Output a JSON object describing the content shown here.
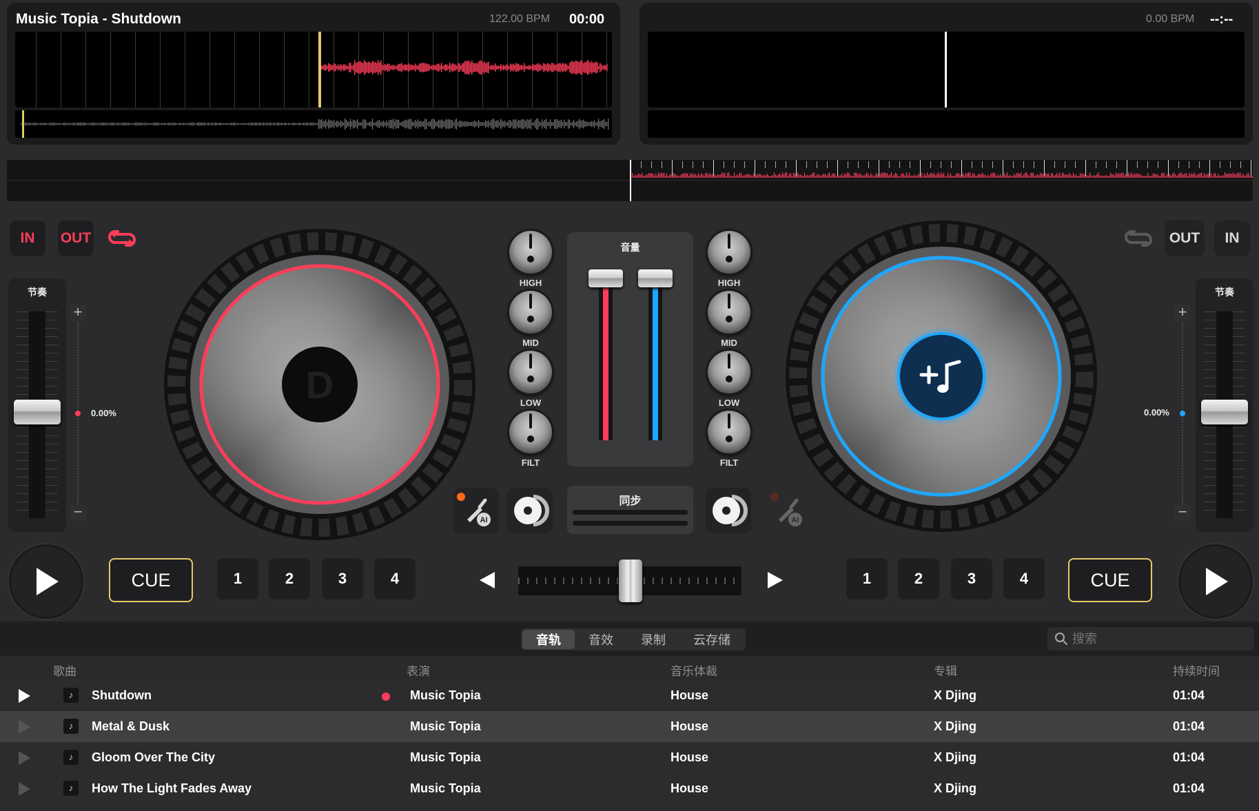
{
  "deckA": {
    "title": "Music Topia - Shutdown",
    "bpm": "122.00 BPM",
    "time": "00:00",
    "pitch_value": "0.00%",
    "pitch_label": "节奏",
    "accent": "#ff3d5a"
  },
  "deckB": {
    "bpm": "0.00 BPM",
    "time": "--:--",
    "pitch_value": "0.00%",
    "pitch_label": "节奏",
    "accent": "#1ea7ff"
  },
  "loop": {
    "in": "IN",
    "out": "OUT"
  },
  "eq": {
    "high": "HIGH",
    "mid": "MID",
    "low": "LOW",
    "filt": "FILT"
  },
  "mixer": {
    "volume_label": "音量",
    "sync_label": "同步"
  },
  "transport": {
    "cue": "CUE",
    "pads": [
      "1",
      "2",
      "3",
      "4"
    ]
  },
  "library": {
    "tabs": [
      "音轨",
      "音效",
      "录制",
      "云存储"
    ],
    "search_placeholder": "搜索",
    "columns": {
      "song": "歌曲",
      "artist": "表演",
      "genre": "音乐体裁",
      "album": "专辑",
      "duration": "持续时间"
    },
    "tracks": [
      {
        "title": "Shutdown",
        "artist": "Music Topia",
        "genre": "House",
        "album": "X Djing",
        "duration": "01:04"
      },
      {
        "title": "Metal & Dusk",
        "artist": "Music Topia",
        "genre": "House",
        "album": "X Djing",
        "duration": "01:04"
      },
      {
        "title": "Gloom Over The City",
        "artist": "Music Topia",
        "genre": "House",
        "album": "X Djing",
        "duration": "01:04"
      },
      {
        "title": "How The Light Fades Away",
        "artist": "Music Topia",
        "genre": "House",
        "album": "X Djing",
        "duration": "01:04"
      }
    ]
  },
  "icons": [
    "loop-icon",
    "play-icon",
    "ai-guitar-icon",
    "disc-icon",
    "add-music-icon",
    "search-icon",
    "music-note-icon",
    "arrow-left-icon",
    "arrow-right-icon"
  ]
}
